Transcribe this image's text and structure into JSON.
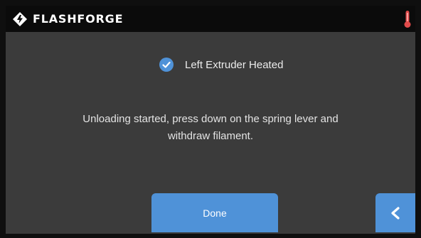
{
  "header": {
    "brand": "FLASHFORGE",
    "logo_icon": "flashforge-logo-icon",
    "temperature_icon": "thermometer-icon",
    "temperature_icon_color": "#e14b4b"
  },
  "status": {
    "checked": true,
    "label": "Left Extruder Heated",
    "check_color": "#4f92d8"
  },
  "message": {
    "line1": "Unloading started, press down on the spring lever and",
    "line2": "withdraw filament."
  },
  "actions": {
    "done_label": "Done",
    "back_icon": "chevron-left-icon",
    "accent": "#4f92d8"
  }
}
